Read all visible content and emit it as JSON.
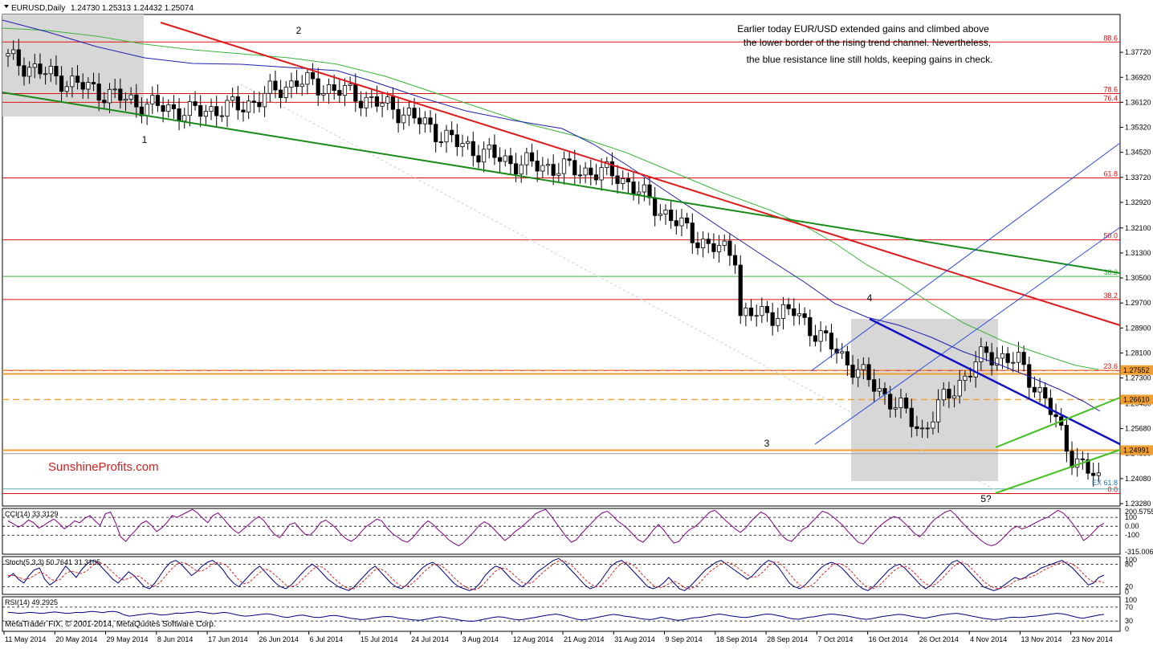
{
  "header": {
    "symbol": "EURUSD,Daily",
    "ohlc": "1.24730 1.25313 1.24432 1.25074"
  },
  "annotation": {
    "lines": [
      "Earlier today EUR/USD extended gains and climbed above",
      "the lower border of the rising trend channel. Nevertheless,",
      "the blue resistance line still holds, keeping gains in check."
    ]
  },
  "watermark": "SunshineProfits.com",
  "copyright": "MetaTrader FIX, © 2001-2014, MetaQuotes Software Corp.",
  "colors": {
    "bull_fill": "#ffffff",
    "bear_fill": "#000000",
    "ma_blue": "#1f1fb0",
    "ma_green": "#3cb43c",
    "fib_red": "#dd1111",
    "green_trend": "#1a8a1a",
    "red_trend": "#e01a1a",
    "orange": "#f0a030",
    "channel_blue": "#2a4ae0",
    "resistance_blue": "#1010c8",
    "channel_green": "#44c020",
    "box_gray": "#d7d7d7",
    "indicator": "#800080"
  },
  "chart_data": [
    {
      "type": "candlestick",
      "panel": "price",
      "yaxis_ticks": [
        "1.37720",
        "1.36920",
        "1.36120",
        "1.35320",
        "1.34520",
        "1.33720",
        "1.32920",
        "1.32100",
        "1.31300",
        "1.30500",
        "1.29700",
        "1.28900",
        "1.28100",
        "1.27300",
        "1.26480",
        "1.25680",
        "1.24880",
        "1.24080",
        "1.23280"
      ],
      "ylim": [
        1.2328,
        1.3852
      ],
      "x_ticks": [
        "11 May 2014",
        "20 May 2014",
        "29 May 2014",
        "8 Jun 2014",
        "17 Jun 2014",
        "26 Jun 2014",
        "6 Jul 2014",
        "15 Jul 2014",
        "24 Jul 2014",
        "3 Aug 2014",
        "12 Aug 2014",
        "21 Aug 2014",
        "31 Aug 2014",
        "9 Sep 2014",
        "18 Sep 2014",
        "28 Sep 2014",
        "7 Oct 2014",
        "16 Oct 2014",
        "26 Oct 2014",
        "4 Nov 2014",
        "13 Nov 2014",
        "23 Nov 2014"
      ],
      "fib_levels": [
        {
          "label": "88.6",
          "price": 1.3805
        },
        {
          "label": "78.6",
          "price": 1.364
        },
        {
          "label": "76.4",
          "price": 1.3612
        },
        {
          "label": "61.8",
          "price": 1.337
        },
        {
          "label": "50.0",
          "price": 1.3172
        },
        {
          "label": "38.2",
          "price": 1.3055,
          "color": "green"
        },
        {
          "label": "38.2",
          "price": 1.2981
        },
        {
          "label": "23.6",
          "price": 1.2754
        },
        {
          "label": "0.0",
          "price": 1.236
        }
      ],
      "price_labels": [
        {
          "text": "1.27552",
          "price": 1.27552
        },
        {
          "text": "1.26610",
          "price": 1.2661
        },
        {
          "text": "1.24991",
          "price": 1.24991
        }
      ],
      "wave_labels": [
        "1",
        "2",
        "3",
        "4",
        "5?"
      ],
      "ex_label": "EX 61.8"
    },
    {
      "type": "line",
      "panel": "indicator",
      "name": "CCI(14) 33.3129",
      "yaxis_ticks": [
        "200.5755",
        "100",
        "0.00",
        "-100",
        "-315.0062"
      ],
      "ylim": [
        -315.0062,
        200.5755
      ],
      "values": [
        60,
        30,
        -10,
        20,
        70,
        40,
        -20,
        10,
        50,
        80,
        30,
        -30,
        10,
        60,
        40,
        90,
        120,
        60,
        10,
        140,
        160,
        40,
        -120,
        -170,
        -100,
        -40,
        30,
        60,
        10,
        -60,
        -20,
        40,
        120,
        100,
        130,
        160,
        190,
        150,
        90,
        40,
        120,
        150,
        90,
        20,
        -40,
        -80,
        -30,
        20,
        70,
        110,
        60,
        -20,
        -90,
        -130,
        -60,
        20,
        40,
        -30,
        -90,
        -100,
        -40,
        40,
        70,
        30,
        -20,
        -90,
        -140,
        -170,
        -130,
        -60,
        0,
        40,
        80,
        60,
        -20,
        -80,
        -120,
        -160,
        -180,
        -130,
        -60,
        10,
        60,
        20,
        -40,
        -90,
        -150,
        -190,
        -220,
        -180,
        -120,
        -60,
        10,
        50,
        20,
        -40,
        -100,
        -160,
        -120,
        -60,
        -20,
        30,
        80,
        140,
        170,
        190,
        120,
        40,
        -40,
        -120,
        -180,
        -150,
        -80,
        -20,
        40,
        100,
        150,
        170,
        120,
        60,
        20,
        -30,
        -90,
        -150,
        -180,
        -120,
        -40,
        20,
        -40,
        -120,
        -190,
        -170,
        -100,
        -40,
        -10,
        40,
        100,
        160,
        180,
        130,
        70,
        20,
        -30,
        -70,
        -20,
        50,
        110,
        160,
        130,
        60,
        -20,
        -100,
        -150,
        -170,
        -110,
        -40,
        -10,
        50,
        110,
        170,
        150,
        110,
        60,
        10,
        -60,
        -120,
        -180,
        -200,
        -140,
        -70,
        -10,
        40,
        80,
        110,
        90,
        40,
        -20,
        -80,
        -120,
        -60,
        20,
        80,
        120,
        160,
        180,
        130,
        60,
        0,
        -60,
        -110,
        -160,
        -200,
        -220,
        -200,
        -150,
        -90,
        -30,
        0,
        -30,
        -10,
        20,
        50,
        80,
        100,
        140,
        180,
        150,
        90,
        20,
        -60,
        -160,
        -120,
        -60,
        0,
        33
      ]
    },
    {
      "type": "line",
      "panel": "indicator",
      "name": "Stoch(5,3,3) 50.7641 31.3105",
      "yaxis_ticks": [
        "100",
        "80",
        "20",
        "0"
      ],
      "ylim": [
        0,
        100
      ],
      "series_main": [
        45,
        55,
        40,
        30,
        50,
        65,
        70,
        40,
        25,
        35,
        55,
        75,
        60,
        45,
        65,
        80,
        90,
        85,
        70,
        55,
        40,
        30,
        45,
        60,
        50,
        35,
        20,
        15,
        30,
        50,
        70,
        85,
        90,
        80,
        65,
        50,
        60,
        75,
        85,
        90,
        80,
        65,
        45,
        30,
        20,
        35,
        50,
        65,
        75,
        60,
        45,
        30,
        20,
        15,
        25,
        40,
        55,
        70,
        80,
        70,
        55,
        40,
        30,
        20,
        15,
        10,
        20,
        35,
        50,
        65,
        75,
        60,
        45,
        30,
        20,
        15,
        25,
        40,
        55,
        70,
        80,
        85,
        75,
        60,
        45,
        30,
        20,
        15,
        10,
        15,
        30,
        50,
        65,
        75,
        70,
        55,
        40,
        30,
        20,
        30,
        45,
        60,
        70,
        80,
        90,
        95,
        85,
        70,
        55,
        40,
        25,
        15,
        20,
        35,
        55,
        75,
        85,
        90,
        80,
        65,
        50,
        35,
        20,
        15,
        20,
        30,
        45,
        30,
        15,
        10,
        20,
        35,
        50,
        65,
        75,
        85,
        90,
        80,
        70,
        60,
        50,
        40,
        50,
        65,
        80,
        90,
        85,
        70,
        50,
        30,
        20,
        15,
        25,
        40,
        55,
        70,
        80,
        85,
        80,
        70,
        55,
        40,
        25,
        15,
        10,
        20,
        35,
        50,
        65,
        75,
        80,
        70,
        55,
        40,
        25,
        15,
        25,
        40,
        55,
        70,
        85,
        90,
        80,
        65,
        50,
        35,
        20,
        15,
        10,
        15,
        25,
        35,
        45,
        40,
        45,
        55,
        60,
        70,
        75,
        80,
        85,
        90,
        80,
        70,
        55,
        40,
        25,
        30,
        45,
        51
      ],
      "series_signal": [
        50,
        50,
        45,
        40,
        42,
        50,
        58,
        55,
        42,
        35,
        40,
        55,
        62,
        58,
        55,
        62,
        75,
        85,
        82,
        72,
        58,
        45,
        38,
        42,
        48,
        48,
        38,
        25,
        22,
        32,
        48,
        65,
        78,
        85,
        82,
        72,
        62,
        62,
        70,
        80,
        85,
        82,
        72,
        55,
        38,
        28,
        32,
        45,
        58,
        68,
        62,
        50,
        38,
        25,
        20,
        25,
        38,
        52,
        65,
        75,
        72,
        60,
        45,
        32,
        22,
        15,
        15,
        25,
        38,
        52,
        65,
        68,
        60,
        45,
        32,
        22,
        20,
        28,
        40,
        55,
        68,
        78,
        80,
        72,
        60,
        45,
        32,
        22,
        15,
        12,
        18,
        32,
        48,
        62,
        70,
        68,
        58,
        45,
        32,
        28,
        32,
        45,
        58,
        70,
        80,
        88,
        90,
        82,
        70,
        55,
        40,
        28,
        20,
        22,
        35,
        52,
        70,
        82,
        85,
        80,
        68,
        52,
        38,
        25,
        18,
        20,
        28,
        35,
        28,
        18,
        14,
        20,
        32,
        48,
        62,
        72,
        82,
        85,
        82,
        72,
        62,
        52,
        45,
        48,
        60,
        75,
        85,
        85,
        72,
        55,
        38,
        25,
        18,
        22,
        32,
        48,
        62,
        75,
        82,
        80,
        72,
        58,
        42,
        28,
        18,
        15,
        22,
        35,
        50,
        63,
        72,
        75,
        68,
        55,
        40,
        28,
        22,
        28,
        40,
        55,
        70,
        82,
        85,
        78,
        65,
        50,
        35,
        25,
        18,
        15,
        18,
        25,
        35,
        40,
        42,
        46,
        52,
        60,
        68,
        74,
        80,
        85,
        85,
        80,
        70,
        55,
        42,
        32,
        35,
        31
      ]
    },
    {
      "type": "line",
      "panel": "indicator",
      "name": "RSI(14) 49.2925",
      "yaxis_ticks": [
        "100",
        "70",
        "30",
        "0"
      ],
      "ylim": [
        0,
        100
      ],
      "values": [
        55,
        54,
        52,
        53,
        55,
        54,
        52,
        53,
        55,
        56,
        54,
        52,
        53,
        55,
        54,
        56,
        58,
        56,
        54,
        57,
        58,
        55,
        48,
        44,
        46,
        48,
        50,
        52,
        50,
        47,
        48,
        50,
        53,
        52,
        54,
        55,
        57,
        55,
        53,
        51,
        53,
        55,
        53,
        49,
        46,
        44,
        45,
        47,
        49,
        51,
        49,
        46,
        42,
        40,
        43,
        46,
        47,
        44,
        41,
        40,
        42,
        45,
        46,
        44,
        41,
        38,
        36,
        34,
        35,
        38,
        40,
        42,
        43,
        42,
        39,
        37,
        35,
        33,
        32,
        34,
        37,
        40,
        42,
        40,
        37,
        35,
        32,
        30,
        29,
        31,
        34,
        37,
        40,
        42,
        41,
        38,
        35,
        33,
        35,
        38,
        40,
        43,
        46,
        48,
        50,
        47,
        43,
        39,
        35,
        33,
        35,
        38,
        41,
        44,
        47,
        49,
        47,
        44,
        42,
        40,
        37,
        35,
        34,
        37,
        41,
        38,
        35,
        32,
        33,
        36,
        39,
        40,
        42,
        45,
        48,
        50,
        48,
        45,
        43,
        41,
        40,
        42,
        45,
        48,
        50,
        49,
        46,
        43,
        39,
        36,
        35,
        38,
        41,
        42,
        45,
        48,
        50,
        49,
        47,
        45,
        42,
        39,
        36,
        35,
        37,
        40,
        43,
        45,
        47,
        49,
        48,
        45,
        42,
        40,
        38,
        41,
        44,
        47,
        49,
        51,
        52,
        50,
        47,
        44,
        41,
        38,
        36,
        34,
        35,
        37,
        40,
        41,
        40,
        41,
        43,
        44,
        46,
        48,
        50,
        52,
        51,
        48,
        44,
        40,
        38,
        41,
        44,
        47,
        49
      ]
    }
  ]
}
